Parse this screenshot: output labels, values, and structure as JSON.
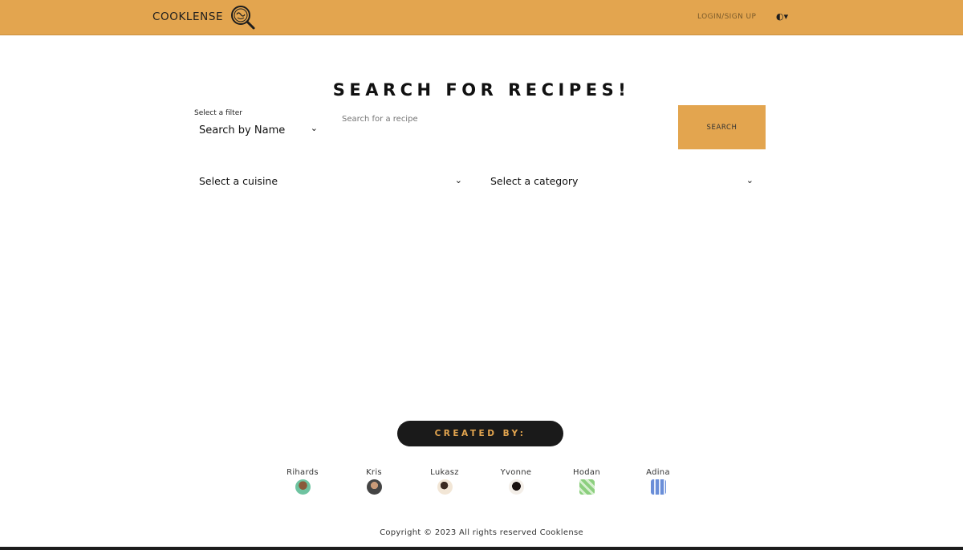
{
  "navbar": {
    "brand": "COOKLENSE",
    "logo_icon": "magnifier-logo-icon",
    "login_label": "LOGIN/SIGN UP",
    "theme_toggle": "◐▾",
    "background": "#e3a54f"
  },
  "main": {
    "title": "SEARCH FOR RECIPES!",
    "filter": {
      "label": "Select a filter",
      "selected": "Search by Name"
    },
    "search": {
      "placeholder": "Search for a recipe",
      "button_label": "SEARCH"
    },
    "cuisine_select": "Select a cuisine",
    "category_select": "Select a category"
  },
  "credits": {
    "heading": "CREATED BY:",
    "members": [
      {
        "name": "Rihards",
        "avatar_color": "#6ec3a0"
      },
      {
        "name": "Kris",
        "avatar_color": "#444444"
      },
      {
        "name": "Lukasz",
        "avatar_color": "#d8b894"
      },
      {
        "name": "Yvonne",
        "avatar_color": "#3a2a22"
      },
      {
        "name": "Hodan",
        "avatar_color": "#8ccf7e"
      },
      {
        "name": "Adina",
        "avatar_color": "#6a8ed8"
      }
    ]
  },
  "footer": {
    "copyright": "Copyright © 2023 All rights reserved Cooklense"
  }
}
